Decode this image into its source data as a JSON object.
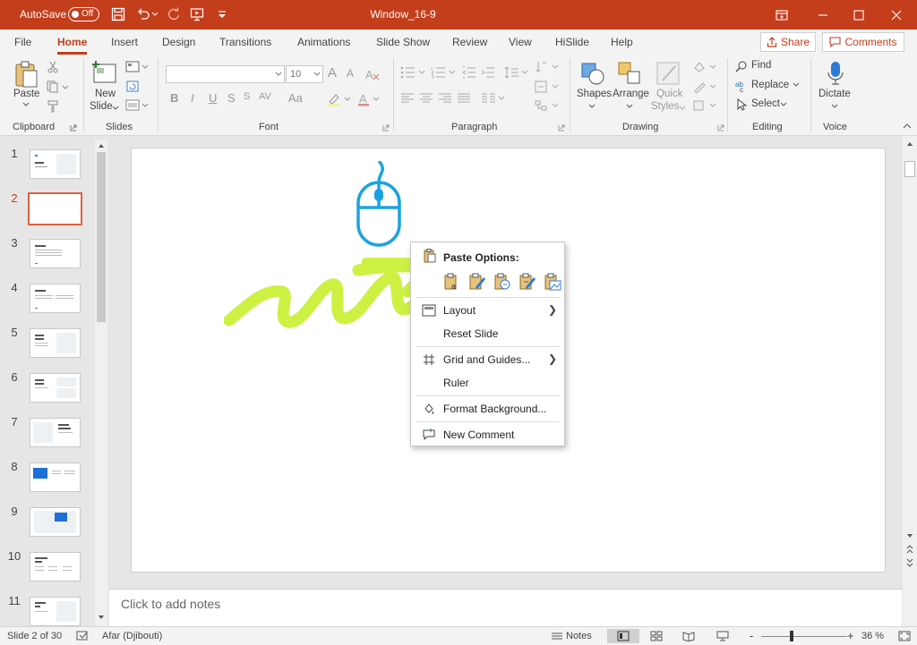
{
  "titlebar": {
    "autosave_label": "AutoSave",
    "autosave_state": "Off",
    "title": "Window_16-9"
  },
  "tabs": [
    "File",
    "Home",
    "Insert",
    "Design",
    "Transitions",
    "Animations",
    "Slide Show",
    "Review",
    "View",
    "HiSlide",
    "Help"
  ],
  "active_tab": "Home",
  "share_label": "Share",
  "comments_label": "Comments",
  "ribbon": {
    "clipboard": {
      "paste": "Paste",
      "group": "Clipboard"
    },
    "slides": {
      "new_slide_line1": "New",
      "new_slide_line2": "Slide",
      "group": "Slides"
    },
    "font": {
      "size": "10",
      "group": "Font",
      "grow": "A",
      "shrink": "A",
      "bold": "B",
      "italic": "I",
      "underline": "U",
      "strike": "S",
      "spacing": "AV",
      "case": "Aa"
    },
    "paragraph": {
      "group": "Paragraph"
    },
    "drawing": {
      "shapes": "Shapes",
      "arrange": "Arrange",
      "quick_line1": "Quick",
      "quick_line2": "Styles",
      "group": "Drawing"
    },
    "editing": {
      "find": "Find",
      "replace": "Replace",
      "select": "Select",
      "group": "Editing"
    },
    "voice": {
      "dictate": "Dictate",
      "group": "Voice"
    }
  },
  "slides": [
    {
      "num": "1"
    },
    {
      "num": "2"
    },
    {
      "num": "3"
    },
    {
      "num": "4"
    },
    {
      "num": "5"
    },
    {
      "num": "6"
    },
    {
      "num": "7"
    },
    {
      "num": "8"
    },
    {
      "num": "9"
    },
    {
      "num": "10"
    },
    {
      "num": "11"
    }
  ],
  "selected_slide": "2",
  "notes_placeholder": "Click to add notes",
  "context_menu": {
    "paste_options_label": "Paste Options:",
    "items": [
      {
        "label": "Layout",
        "submenu": true
      },
      {
        "label": "Reset Slide",
        "submenu": false
      },
      {
        "label": "Grid and Guides...",
        "submenu": true
      },
      {
        "label": "Ruler",
        "submenu": false
      },
      {
        "label": "Format Background...",
        "submenu": false
      },
      {
        "label": "New Comment",
        "submenu": false
      }
    ]
  },
  "status": {
    "slide_info": "Slide 2 of 30",
    "language": "Afar (Djibouti)",
    "notes": "Notes",
    "zoom_minus": "-",
    "zoom_plus": "+",
    "zoom": "36 %"
  },
  "colors": {
    "accent": "#c43e1c",
    "mouse_icon": "#1aa3e0",
    "scribble": "#c7ef2e"
  }
}
